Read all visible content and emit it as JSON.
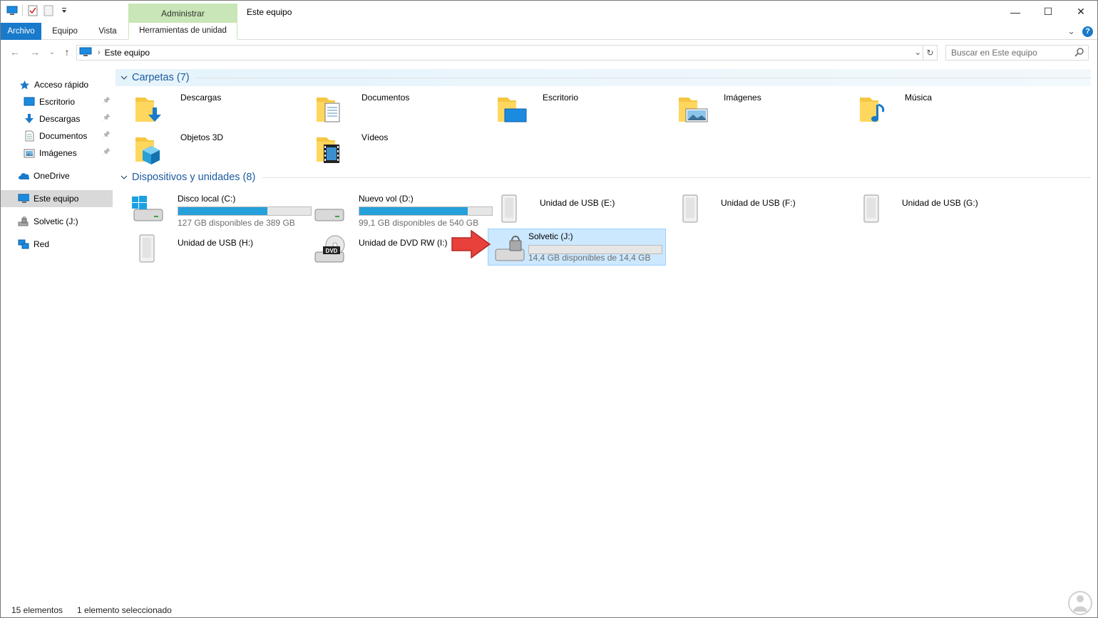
{
  "window": {
    "title": "Este equipo",
    "context_tab_group": "Administrar",
    "controls": {
      "minimize": "—",
      "maximize": "☐",
      "close": "✕"
    }
  },
  "ribbon": {
    "tabs": [
      "Archivo",
      "Equipo",
      "Vista",
      "Herramientas de unidad"
    ],
    "expand": "⌄",
    "help": "?"
  },
  "navigation": {
    "back": "←",
    "forward": "→",
    "recent": "⌄",
    "up": "↑",
    "breadcrumb_sep": "›",
    "breadcrumb": "Este equipo",
    "address_dropdown": "⌄",
    "refresh": "↻",
    "search_placeholder": "Buscar en Este equipo"
  },
  "sidebar": {
    "quick_access": "Acceso rápido",
    "pin": "📌",
    "pinned": [
      {
        "label": "Escritorio",
        "icon": "desktop-icon"
      },
      {
        "label": "Descargas",
        "icon": "download-icon"
      },
      {
        "label": "Documentos",
        "icon": "document-icon"
      },
      {
        "label": "Imágenes",
        "icon": "image-icon"
      }
    ],
    "onedrive": "OneDrive",
    "this_pc": "Este equipo",
    "solvetic": "Solvetic (J:)",
    "network": "Red"
  },
  "content": {
    "folders_header": "Carpetas (7)",
    "folders": [
      {
        "name": "Descargas",
        "icon": "downloads-folder-icon"
      },
      {
        "name": "Documentos",
        "icon": "documents-folder-icon"
      },
      {
        "name": "Escritorio",
        "icon": "desktop-folder-icon"
      },
      {
        "name": "Imágenes",
        "icon": "pictures-folder-icon"
      },
      {
        "name": "Música",
        "icon": "music-folder-icon"
      },
      {
        "name": "Objetos 3D",
        "icon": "3d-objects-folder-icon"
      },
      {
        "name": "Vídeos",
        "icon": "videos-folder-icon"
      }
    ],
    "devices_header": "Dispositivos y unidades (8)",
    "drives": {
      "c": {
        "name": "Disco local (C:)",
        "free": "127 GB disponibles de 389 GB",
        "used_fraction": 0.674
      },
      "d": {
        "name": "Nuevo vol (D:)",
        "free": "99,1 GB disponibles de 540 GB",
        "used_fraction": 0.817
      },
      "e": {
        "name": "Unidad de USB (E:)"
      },
      "f": {
        "name": "Unidad de USB (F:)"
      },
      "g": {
        "name": "Unidad de USB (G:)"
      },
      "h": {
        "name": "Unidad de USB (H:)"
      },
      "i": {
        "name": "Unidad de DVD RW (I:)",
        "badge": "DVD"
      },
      "j": {
        "name": "Solvetic (J:)",
        "free": "14,4 GB disponibles de 14,4 GB",
        "used_fraction": 0.0
      }
    }
  },
  "status_bar": {
    "count": "15 elementos",
    "selection": "1 elemento seleccionado"
  },
  "colors": {
    "accent": "#1979ca",
    "context_tab": "#c8e6b7",
    "capacity_bar": "#26a0da",
    "selection": "#cce8ff",
    "arrow": "#e8403a"
  }
}
